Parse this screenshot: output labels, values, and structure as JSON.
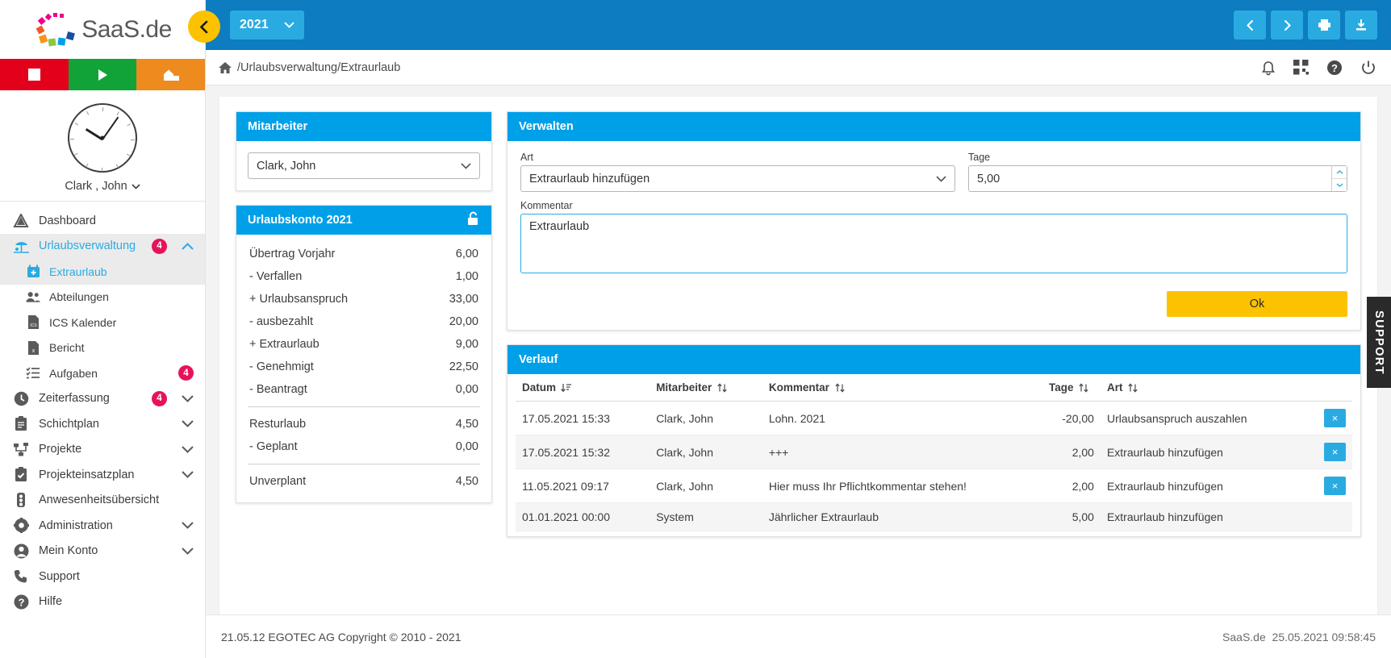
{
  "brand": {
    "name": "SaaS.de",
    "accent": "#00a0e9",
    "header_blue": "#0d7cc1",
    "yellow": "#fcc200",
    "badge_pink": "#e8125b"
  },
  "sidebar": {
    "user_name": "Clark , John",
    "quick_actions": [
      {
        "name": "stop",
        "color": "#e2001a"
      },
      {
        "name": "play",
        "color": "#12a338"
      },
      {
        "name": "home-work",
        "color": "#ed8b1f"
      }
    ],
    "items": [
      {
        "label": "Dashboard",
        "icon": "dashboard-icon",
        "badge": null,
        "chevron": null,
        "state": "normal",
        "sub": false
      },
      {
        "label": "Urlaubsverwaltung",
        "icon": "beach-icon",
        "badge": "4",
        "chevron": "up",
        "state": "active-parent",
        "sub": false
      },
      {
        "label": "Extraurlaub",
        "icon": "calendar-plus-icon",
        "badge": null,
        "chevron": null,
        "state": "active-sub",
        "sub": true
      },
      {
        "label": "Abteilungen",
        "icon": "people-icon",
        "badge": null,
        "chevron": null,
        "state": "normal",
        "sub": true
      },
      {
        "label": "ICS Kalender",
        "icon": "file-ics-icon",
        "badge": null,
        "chevron": null,
        "state": "normal",
        "sub": true
      },
      {
        "label": "Bericht",
        "icon": "file-xls-icon",
        "badge": null,
        "chevron": null,
        "state": "normal",
        "sub": true
      },
      {
        "label": "Aufgaben",
        "icon": "tasklist-icon",
        "badge": "4",
        "chevron": null,
        "state": "normal",
        "sub": true
      },
      {
        "label": "Zeiterfassung",
        "icon": "clock-icon",
        "badge": "4",
        "chevron": "down",
        "state": "normal",
        "sub": false
      },
      {
        "label": "Schichtplan",
        "icon": "clipboard-icon",
        "badge": null,
        "chevron": "down",
        "state": "normal",
        "sub": false
      },
      {
        "label": "Projekte",
        "icon": "hierarchy-icon",
        "badge": null,
        "chevron": "down",
        "state": "normal",
        "sub": false
      },
      {
        "label": "Projekteinsatzplan",
        "icon": "clipboard-check-icon",
        "badge": null,
        "chevron": "down",
        "state": "normal",
        "sub": false
      },
      {
        "label": "Anwesenheitsübersicht",
        "icon": "traffic-light-icon",
        "badge": null,
        "chevron": null,
        "state": "normal",
        "sub": false
      },
      {
        "label": "Administration",
        "icon": "gear-icon",
        "badge": null,
        "chevron": "down",
        "state": "normal",
        "sub": false
      },
      {
        "label": "Mein Konto",
        "icon": "user-circle-icon",
        "badge": null,
        "chevron": "down",
        "state": "normal",
        "sub": false
      },
      {
        "label": "Support",
        "icon": "phone-icon",
        "badge": null,
        "chevron": null,
        "state": "normal",
        "sub": false
      },
      {
        "label": "Hilfe",
        "icon": "question-circle-icon",
        "badge": null,
        "chevron": null,
        "state": "normal",
        "sub": false
      }
    ]
  },
  "topbar": {
    "year": "2021",
    "buttons": [
      {
        "name": "prev-button",
        "icon": "chevron-left-icon"
      },
      {
        "name": "next-button",
        "icon": "chevron-right-icon"
      },
      {
        "name": "print-button",
        "icon": "printer-icon"
      },
      {
        "name": "download-button",
        "icon": "download-icon"
      }
    ],
    "collapse_icon": "chevron-left-icon"
  },
  "breadcrumb": {
    "home_icon": "home-icon",
    "path": "/Urlaubsverwaltung/Extraurlaub",
    "icons": [
      {
        "name": "notification-bell-icon"
      },
      {
        "name": "apps-grid-icon"
      },
      {
        "name": "help-circle-icon"
      },
      {
        "name": "power-icon"
      }
    ]
  },
  "employee_panel": {
    "title": "Mitarbeiter",
    "selected": "Clark, John",
    "options": [
      "Clark, John"
    ]
  },
  "account_panel": {
    "title": "Urlaubskonto 2021",
    "lock_icon": "unlock-icon",
    "rows": [
      {
        "label": "Übertrag Vorjahr",
        "value": "6,00"
      },
      {
        "label": "- Verfallen",
        "value": "1,00"
      },
      {
        "label": "+ Urlaubsanspruch",
        "value": "33,00"
      },
      {
        "label": "- ausbezahlt",
        "value": "20,00"
      },
      {
        "label": "+ Extraurlaub",
        "value": "9,00"
      },
      {
        "label": "- Genehmigt",
        "value": "22,50"
      },
      {
        "label": "- Beantragt",
        "value": "0,00"
      }
    ],
    "rows2": [
      {
        "label": "Resturlaub",
        "value": "4,50"
      },
      {
        "label": "- Geplant",
        "value": "0,00"
      }
    ],
    "rows3": [
      {
        "label": "Unverplant",
        "value": "4,50"
      }
    ]
  },
  "manage_panel": {
    "title": "Verwalten",
    "art_label": "Art",
    "art_value": "Extraurlaub hinzufügen",
    "art_options": [
      "Extraurlaub hinzufügen",
      "Urlaubsanspruch auszahlen"
    ],
    "tage_label": "Tage",
    "tage_value": "5,00",
    "kommentar_label": "Kommentar",
    "kommentar_value": "Extraurlaub",
    "ok_label": "Ok"
  },
  "history_panel": {
    "title": "Verlauf",
    "columns": [
      {
        "label": "Datum",
        "sort": "desc"
      },
      {
        "label": "Mitarbeiter",
        "sort": "none"
      },
      {
        "label": "Kommentar",
        "sort": "none"
      },
      {
        "label": "Tage",
        "sort": "none"
      },
      {
        "label": "Art",
        "sort": "none"
      }
    ],
    "rows": [
      {
        "datum": "17.05.2021 15:33",
        "mitarbeiter": "Clark, John",
        "kommentar": "Lohn. 2021",
        "tage": "-20,00",
        "negative": true,
        "art": "Urlaubsanspruch auszahlen",
        "deletable": true
      },
      {
        "datum": "17.05.2021 15:32",
        "mitarbeiter": "Clark, John",
        "kommentar": "+++",
        "tage": "2,00",
        "negative": false,
        "art": "Extraurlaub hinzufügen",
        "deletable": true
      },
      {
        "datum": "11.05.2021 09:17",
        "mitarbeiter": "Clark, John",
        "kommentar": "Hier muss Ihr Pflichtkommentar stehen!",
        "tage": "2,00",
        "negative": false,
        "art": "Extraurlaub hinzufügen",
        "deletable": true
      },
      {
        "datum": "01.01.2021 00:00",
        "mitarbeiter": "System",
        "kommentar": "Jährlicher Extraurlaub",
        "tage": "5,00",
        "negative": false,
        "art": "Extraurlaub hinzufügen",
        "deletable": false
      }
    ],
    "delete_label": "×"
  },
  "footer": {
    "left": "21.05.12 EGOTEC AG Copyright © 2010 - 2021",
    "right_brand": "SaaS.de",
    "right_time": "25.05.2021 09:58:45"
  },
  "support_tab": {
    "label": "SUPPORT"
  }
}
